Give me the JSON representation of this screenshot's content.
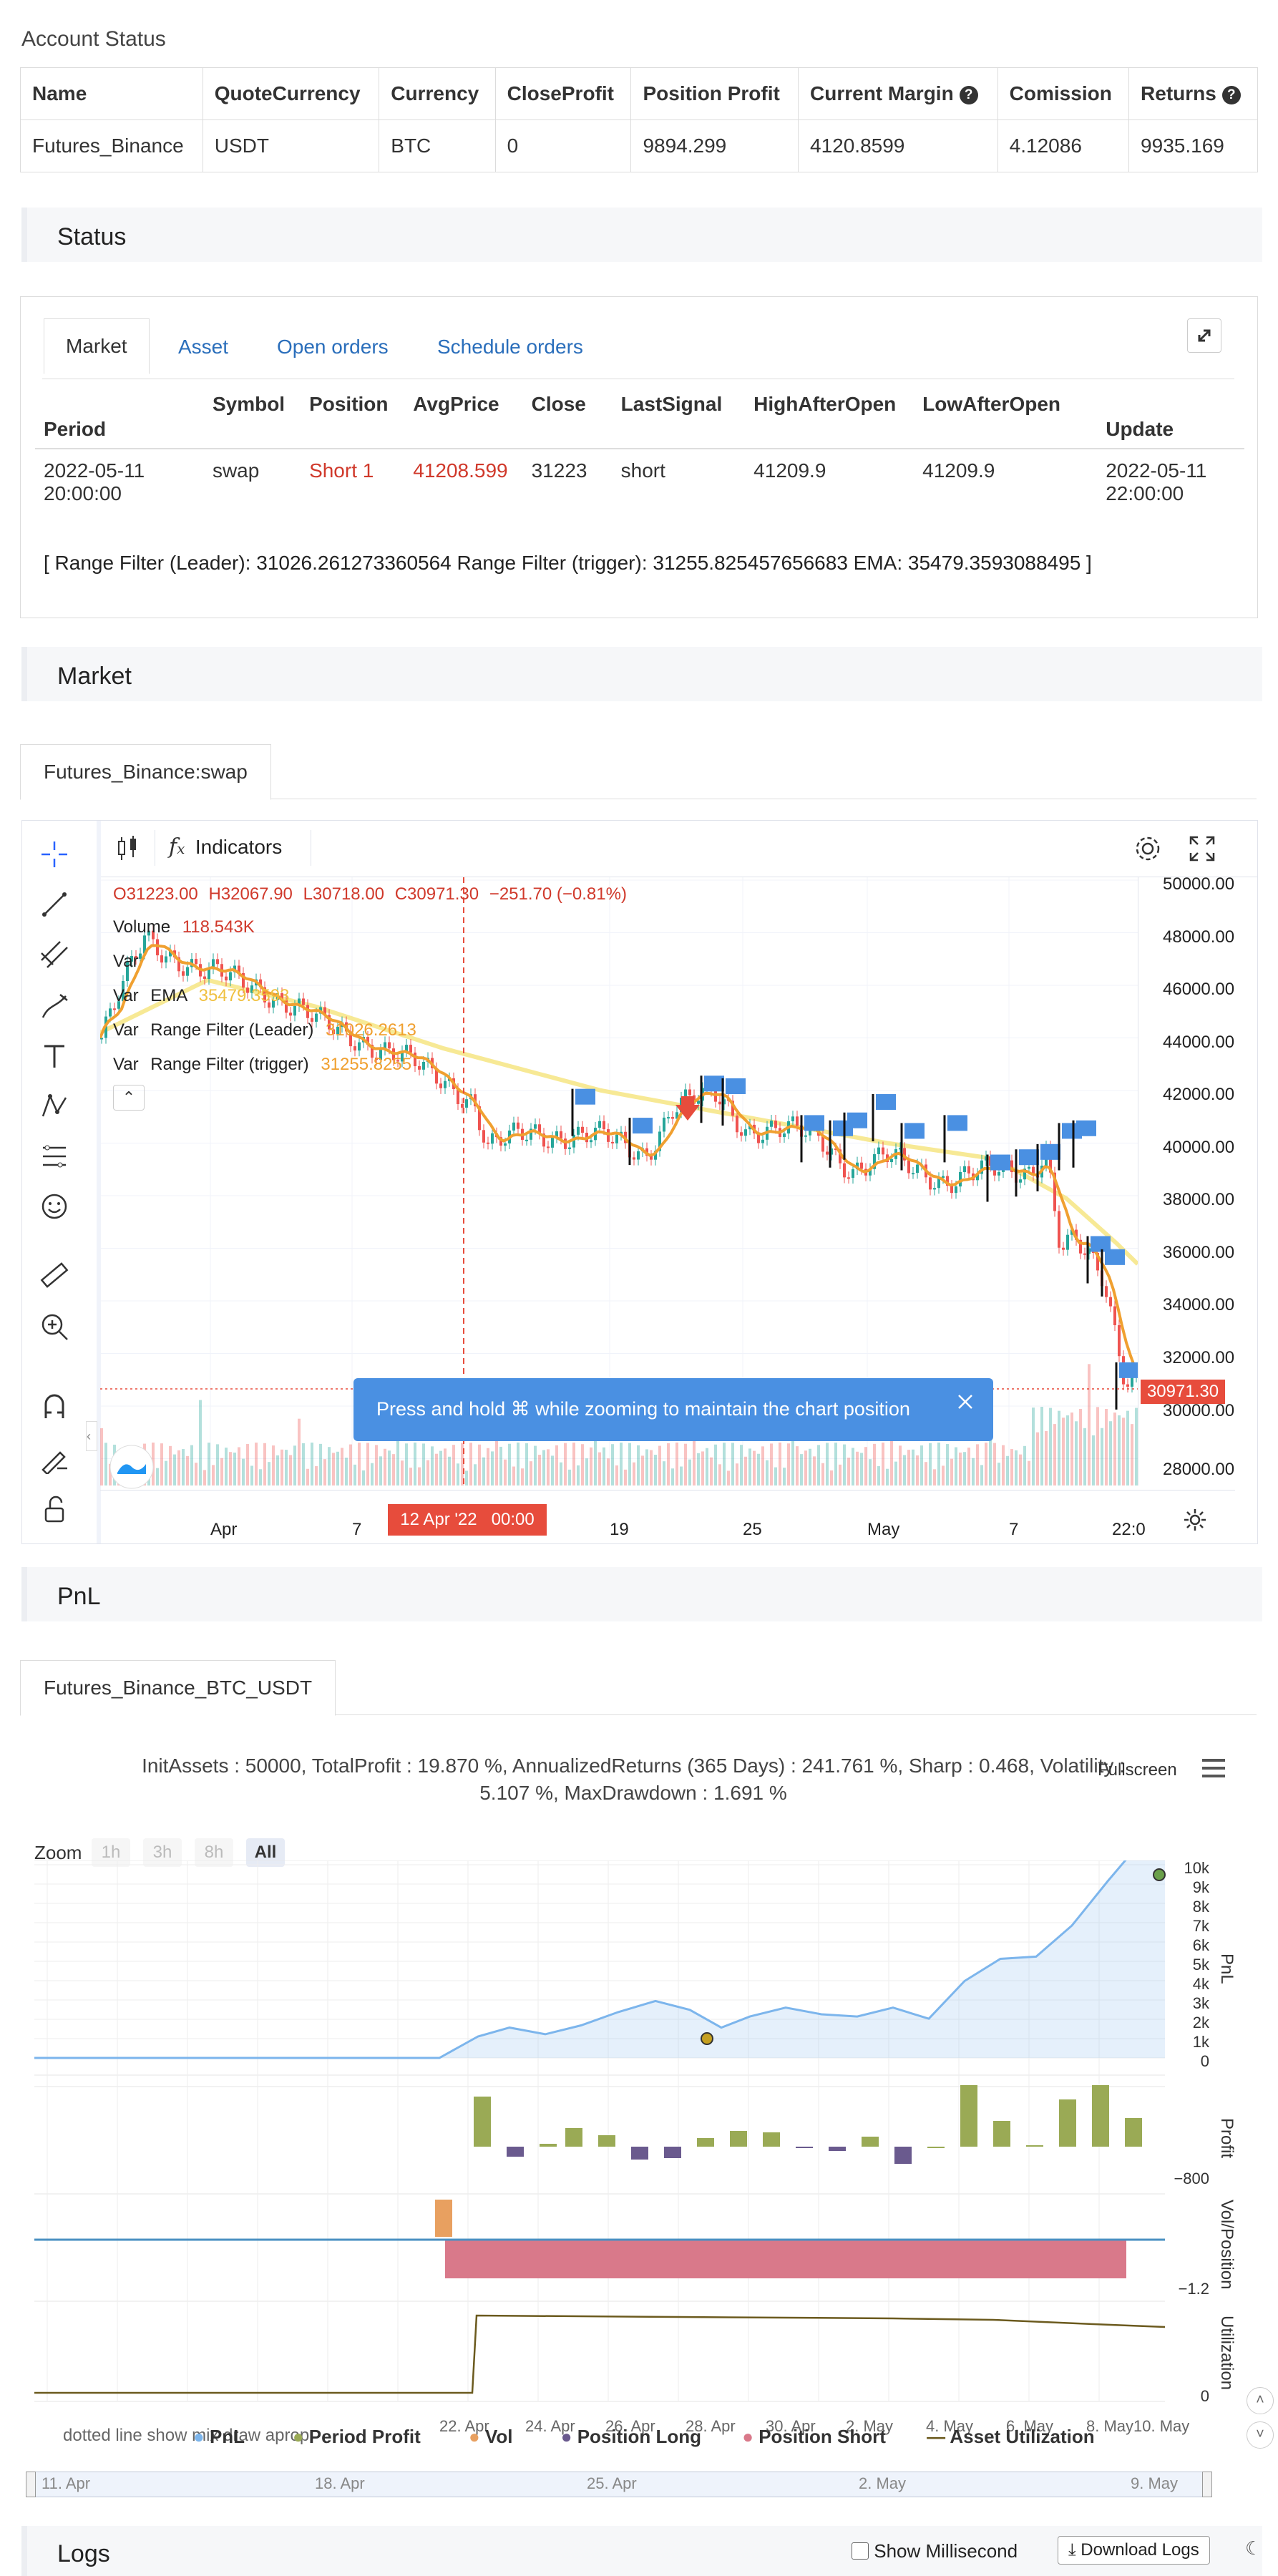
{
  "account": {
    "title": "Account Status",
    "headers": [
      "Name",
      "QuoteCurrency",
      "Currency",
      "CloseProfit",
      "Position Profit",
      "Current Margin",
      "Comission",
      "Returns"
    ],
    "row": [
      "Futures_Binance",
      "USDT",
      "BTC",
      "0",
      "9894.299",
      "4120.8599",
      "4.12086",
      "9935.169"
    ],
    "help_icon": "?"
  },
  "status": {
    "title": "Status",
    "tabs": [
      "Market",
      "Asset",
      "Open orders",
      "Schedule orders"
    ],
    "headers": [
      "Period",
      "Symbol",
      "Position",
      "AvgPrice",
      "Close",
      "LastSignal",
      "HighAfterOpen",
      "LowAfterOpen",
      "Update"
    ],
    "row": {
      "period": "2022-05-11 20:00:00",
      "symbol": "swap",
      "position": "Short 1",
      "avgprice": "41208.599",
      "close": "31223",
      "lastsignal": "short",
      "high": "41209.9",
      "low": "41209.9",
      "update": "2022-05-11 22:00:00"
    },
    "info": "[ Range Filter (Leader): 31026.261273360564 Range Filter (trigger): 31255.825457656683 EMA: 35479.3593088495 ]",
    "colors": {
      "short": "#d0392b"
    }
  },
  "market": {
    "title": "Market",
    "tab": "Futures_Binance:swap",
    "toolbar": {
      "indicators": "Indicators"
    },
    "ohlc": {
      "o": "O31223.00",
      "h": "H32067.90",
      "l": "L30718.00",
      "c": "C30971.30",
      "chg": "−251.70 (−0.81%)"
    },
    "legend": {
      "volume_label": "Volume",
      "volume_value": "118.543K",
      "var1": "Var",
      "var2_label": "Var",
      "var2_name": "EMA",
      "var2_value": "35479.3593",
      "var3_label": "Var",
      "var3_name": "Range Filter (Leader)",
      "var3_value": "31026.2613",
      "var4_label": "Var",
      "var4_name": "Range Filter (trigger)",
      "var4_value": "31255.8255"
    },
    "price_axis": [
      "50000.00",
      "48000.00",
      "46000.00",
      "44000.00",
      "42000.00",
      "40000.00",
      "38000.00",
      "36000.00",
      "34000.00",
      "32000.00",
      "30000.00",
      "28000.00"
    ],
    "last_price": "30971.30",
    "time_axis": [
      "Apr",
      "7",
      "19",
      "25",
      "May",
      "7",
      "22:0"
    ],
    "crosshair_time": "12 Apr '22   00:00",
    "toast": "Press and hold ⌘ while zooming to maintain the chart position",
    "colors": {
      "ema": "#f5e47a",
      "range": "#f0a030",
      "candle_up": "#26a69a",
      "candle_down": "#ef5350",
      "flag": "#4a90e2",
      "last": "#e74c3c"
    }
  },
  "pnl": {
    "title": "PnL",
    "tab": "Futures_Binance_BTC_USDT",
    "summary_line1": "InitAssets : 50000, TotalProfit : 19.870 %, AnnualizedReturns (365 Days) : 241.761 %, Sharp : 0.468, Volatility :",
    "summary_line2": "5.107 %, MaxDrawdown : 1.691 %",
    "fullscreen": "Fullscreen",
    "zoom_label": "Zoom",
    "zoom_buttons": [
      "1h",
      "3h",
      "8h",
      "All"
    ],
    "pnl_ticks": [
      "10k",
      "9k",
      "8k",
      "7k",
      "6k",
      "5k",
      "4k",
      "3k",
      "2k",
      "1k",
      "0"
    ],
    "profit_tick": "−800",
    "vol_tick": "−1.2",
    "util_tick": "0",
    "axis_titles": [
      "PnL",
      "Profit",
      "Vol/Position",
      "Utilization"
    ],
    "x_dates": [
      "22. Apr",
      "24. Apr",
      "26. Apr",
      "28. Apr",
      "30. Apr",
      "2. May",
      "4. May",
      "6. May",
      "8. May",
      "10. May"
    ],
    "legend_items": [
      "PnL",
      "Period Profit",
      "Vol",
      "Position Long",
      "Position Short",
      "Asset Utilization"
    ],
    "legend_overlap": "dotted line show mix draw aprop",
    "navigator_dates": [
      "11. Apr",
      "18. Apr",
      "25. Apr",
      "2. May",
      "9. May"
    ],
    "colors": {
      "pnl": "#7cb5ec",
      "profit": "#9aaa55",
      "vol": "#e8a060",
      "long": "#6a5a8e",
      "short": "#d9798a",
      "util": "#6b5a1e"
    }
  },
  "logs": {
    "title": "Logs",
    "show_ms": "Show Millisecond",
    "download": "Download Logs"
  }
}
